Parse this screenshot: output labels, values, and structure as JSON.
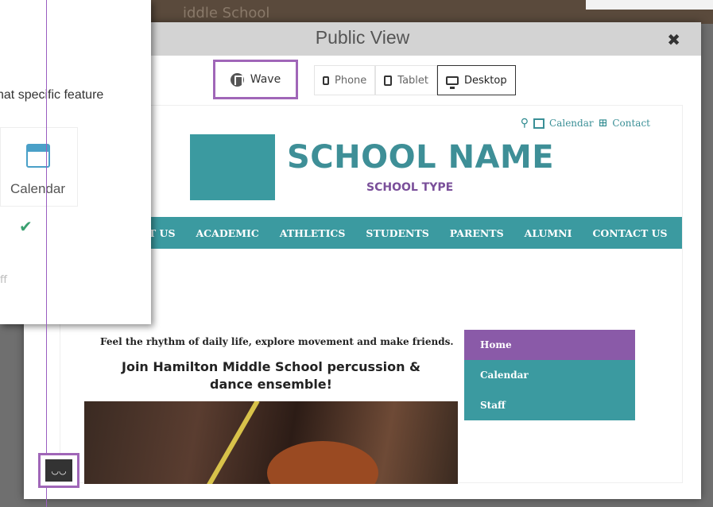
{
  "background": {
    "title": "iddle School"
  },
  "modal": {
    "title": "Public View",
    "close_label": "✖"
  },
  "toolbar": {
    "wave_label": "Wave",
    "devices": [
      {
        "label": "Phone",
        "icon": "phone-icon",
        "active": false
      },
      {
        "label": "Tablet",
        "icon": "tablet-icon",
        "active": false
      },
      {
        "label": "Desktop",
        "icon": "desktop-icon",
        "active": true
      }
    ]
  },
  "site": {
    "utility": {
      "search_icon": "⚲",
      "calendar_label": "Calendar",
      "contact_label": "Contact"
    },
    "school_name": "SCHOOL NAME",
    "school_type": "SCHOOL TYPE",
    "nav": [
      "UT US",
      "ACADEMIC",
      "ATHLETICS",
      "STUDENTS",
      "PARENTS",
      "ALUMNI",
      "CONTACT US"
    ],
    "tagline": "Feel the rhythm of daily life, explore movement and make friends.",
    "promo": "Join Hamilton Middle School percussion & dance ensemble!",
    "sidenav": [
      "Home",
      "Calendar",
      "Staff"
    ]
  },
  "popover": {
    "text": "hat specific feature",
    "card_label": "Calendar",
    "check": "✔",
    "off_label": "ff"
  },
  "colors": {
    "teal": "#3b9aa0",
    "purple": "#8a5aa8",
    "highlight": "#a066b8"
  }
}
